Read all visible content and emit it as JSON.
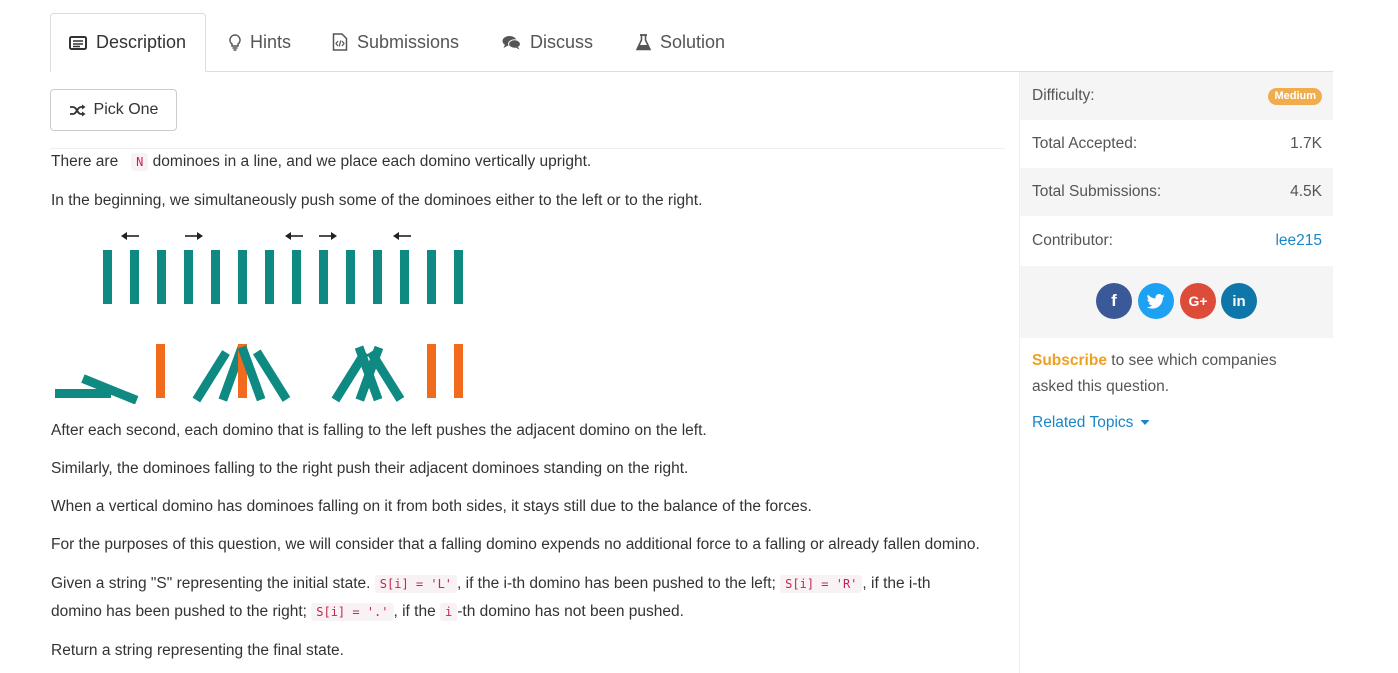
{
  "tabs": [
    {
      "label": "Description",
      "icon": "description-icon"
    },
    {
      "label": "Hints",
      "icon": "lightbulb-icon"
    },
    {
      "label": "Submissions",
      "icon": "code-file-icon"
    },
    {
      "label": "Discuss",
      "icon": "comments-icon"
    },
    {
      "label": "Solution",
      "icon": "flask-icon"
    }
  ],
  "pick_one": "Pick One",
  "problem": {
    "p1": {
      "a": "There are",
      "code": "N",
      "b": "dominoes in a line, and we place each domino vertically upright."
    },
    "p2": "In the beginning, we simultaneously push some of the dominoes either to the left or to the right.",
    "p3": "After each second, each domino that is falling to the left pushes the adjacent domino on the left.",
    "p4": "Similarly, the dominoes falling to the right push their adjacent dominoes standing on the right.",
    "p5": "When a vertical domino has dominoes falling on it from both sides, it stays still due to the balance of the forces.",
    "p6": "For the purposes of this question, we will consider that a falling domino expends no additional force to a falling or already fallen domino.",
    "p7": {
      "a": "Given a string \"S\" representing the initial state.",
      "c1": "S[i] = 'L'",
      "b": ", if the i-th domino has been pushed to the left;",
      "c2": "S[i] = 'R'",
      "c": ", if the i-th",
      "d": "domino has been pushed to the right;",
      "c3": "S[i] = '.'",
      "e": ", if the",
      "c4": "i",
      "f": "-th domino has not been pushed."
    },
    "p8": "Return a string representing the final state."
  },
  "sidebar": {
    "difficulty_label": "Difficulty:",
    "difficulty_value": "Medium",
    "accepted_label": "Total Accepted:",
    "accepted_value": "1.7K",
    "submissions_label": "Total Submissions:",
    "submissions_value": "4.5K",
    "contributor_label": "Contributor:",
    "contributor_value": "lee215",
    "share": [
      {
        "icon": "facebook-icon",
        "text": "f",
        "color": "#3b5998"
      },
      {
        "icon": "twitter-icon",
        "text": "",
        "color": "#1da1f2"
      },
      {
        "icon": "google-plus-icon",
        "text": "G+",
        "color": "#dd4b39"
      },
      {
        "icon": "linkedin-icon",
        "text": "in",
        "color": "#0e76a8"
      }
    ],
    "subscribe_link": "Subscribe",
    "subscribe_text_1": " to see which companies",
    "subscribe_text_2": "asked this question.",
    "related_topics": "Related Topics"
  },
  "colors": {
    "teal": "#0e8a82",
    "orange": "#f26a1b",
    "badge": "#f0ad4e",
    "link": "#1a86c7"
  }
}
